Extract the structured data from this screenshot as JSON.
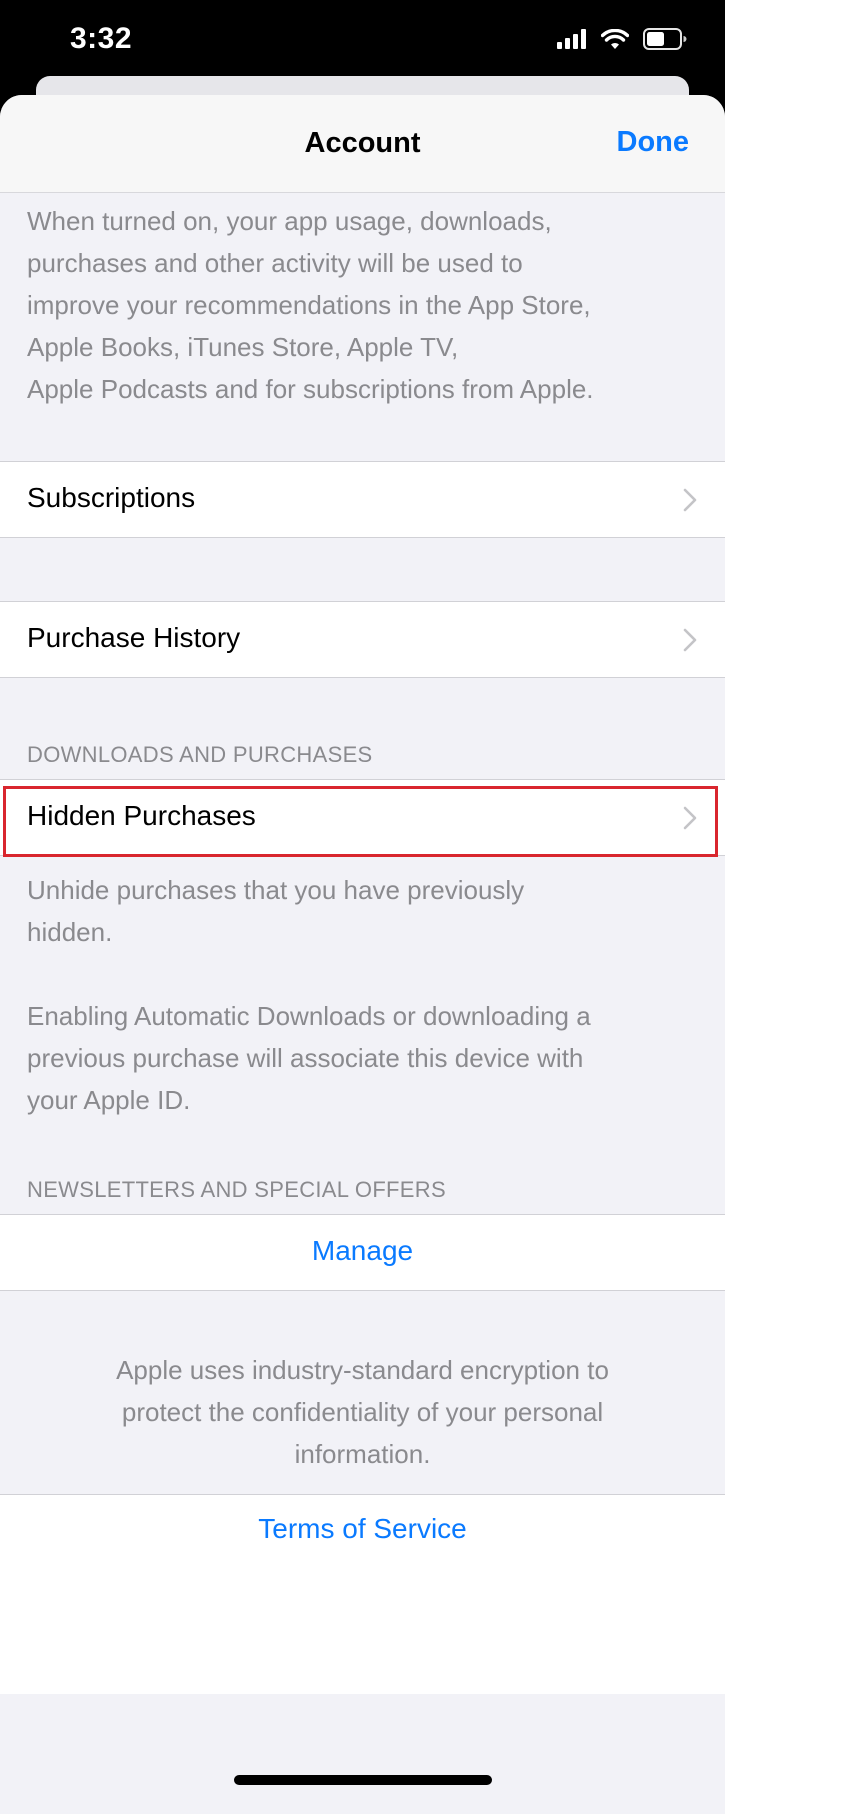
{
  "status_bar": {
    "time": "3:32"
  },
  "nav": {
    "title": "Account",
    "done_label": "Done"
  },
  "recommendations_footer": {
    "lines": [
      "When turned on, your app usage, downloads,",
      "purchases and other activity will be used to",
      "improve your recommendations in the App Store,",
      "Apple Books, iTunes Store, Apple TV,",
      "Apple Podcasts and for subscriptions from Apple."
    ]
  },
  "rows": {
    "subscriptions": "Subscriptions",
    "purchase_history": "Purchase History",
    "hidden_purchases": "Hidden Purchases"
  },
  "sections": {
    "downloads_header": "DOWNLOADS AND PURCHASES",
    "newsletters_header": "NEWSLETTERS AND SPECIAL OFFERS"
  },
  "hidden_footer": {
    "lines": [
      "Unhide purchases that you have previously",
      "hidden."
    ]
  },
  "auto_download_footer": {
    "lines": [
      "Enabling Automatic Downloads or downloading a",
      "previous purchase will associate this device with",
      "your Apple ID."
    ]
  },
  "manage": {
    "label": "Manage"
  },
  "encryption_note": {
    "lines": [
      "Apple uses industry-standard encryption to",
      "protect the confidentiality of your personal",
      "information."
    ]
  },
  "terms": {
    "label": "Terms of Service"
  },
  "colors": {
    "accent": "#0a7aff",
    "highlight": "#d9262e",
    "group_background": "#f2f2f7"
  }
}
